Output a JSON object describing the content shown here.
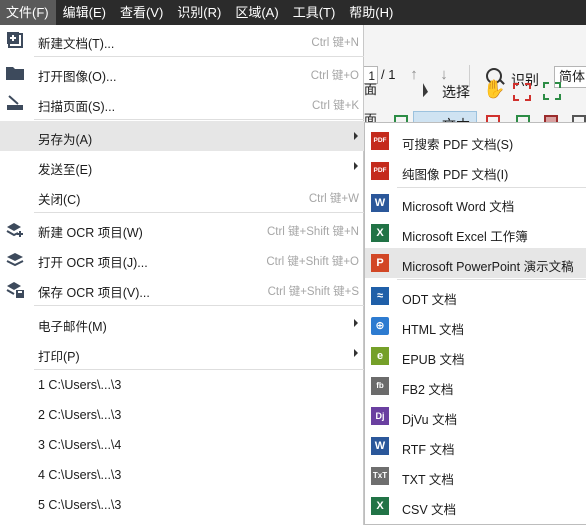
{
  "menubar": {
    "items": [
      "文件(F)",
      "编辑(E)",
      "查看(V)",
      "识别(R)",
      "区域(A)",
      "工具(T)",
      "帮助(H)"
    ]
  },
  "toolbar": {
    "page_total": "/ 1",
    "recognize_label": "识别",
    "language_value": "简体中",
    "select_label": "选择",
    "text_label": "文本",
    "side_fragments": [
      "面",
      "面"
    ]
  },
  "file_menu": {
    "new_doc": {
      "label": "新建文档(T)...",
      "shortcut": "Ctrl 键+N"
    },
    "open_image": {
      "label": "打开图像(O)...",
      "shortcut": "Ctrl 键+O"
    },
    "scan_pages": {
      "label": "扫描页面(S)...",
      "shortcut": "Ctrl 键+K"
    },
    "save_as": {
      "label": "另存为(A)"
    },
    "send_to": {
      "label": "发送至(E)"
    },
    "close": {
      "label": "关闭(C)",
      "shortcut": "Ctrl 键+W"
    },
    "new_ocr": {
      "label": "新建 OCR 项目(W)",
      "shortcut": "Ctrl 键+Shift 键+N"
    },
    "open_ocr": {
      "label": "打开 OCR 项目(J)...",
      "shortcut": "Ctrl 键+Shift 键+O"
    },
    "save_ocr": {
      "label": "保存 OCR 项目(V)...",
      "shortcut": "Ctrl 键+Shift 键+S"
    },
    "email": {
      "label": "电子邮件(M)"
    },
    "print": {
      "label": "打印(P)"
    },
    "recent": [
      "1 C:\\Users\\...\\3",
      "2 C:\\Users\\...\\3",
      "3 C:\\Users\\...\\4",
      "4 C:\\Users\\...\\3",
      "5 C:\\Users\\...\\3"
    ]
  },
  "save_as_menu": {
    "items": [
      {
        "label": "可搜索 PDF 文档(S)",
        "icon": "pdf-icon",
        "icon_text": "PDF"
      },
      {
        "label": "纯图像 PDF 文档(I)",
        "icon": "pdf-icon",
        "icon_text": "PDF"
      },
      {
        "label": "Microsoft Word 文档",
        "icon": "word-icon",
        "icon_text": "W"
      },
      {
        "label": "Microsoft Excel 工作簿",
        "icon": "excel-icon",
        "icon_text": "X"
      },
      {
        "label": "Microsoft PowerPoint 演示文稿",
        "icon": "powerpoint-icon",
        "icon_text": "P"
      },
      {
        "label": "ODT 文档",
        "icon": "odt-icon",
        "icon_text": "≈"
      },
      {
        "label": "HTML 文档",
        "icon": "html-icon",
        "icon_text": "⊕"
      },
      {
        "label": "EPUB 文档",
        "icon": "epub-icon",
        "icon_text": "e"
      },
      {
        "label": "FB2 文档",
        "icon": "fb2-icon",
        "icon_text": "fb"
      },
      {
        "label": "DjVu 文档",
        "icon": "djvu-icon",
        "icon_text": "Dj"
      },
      {
        "label": "RTF 文档",
        "icon": "rtf-icon",
        "icon_text": "W"
      },
      {
        "label": "TXT 文档",
        "icon": "txt-icon",
        "icon_text": "TxT"
      },
      {
        "label": "CSV 文档",
        "icon": "csv-icon",
        "icon_text": "X"
      }
    ]
  },
  "colors": {
    "menubar_bg": "#2b2b2b",
    "highlight": "#e6e6e6",
    "shortcut": "#a6a6a6"
  }
}
